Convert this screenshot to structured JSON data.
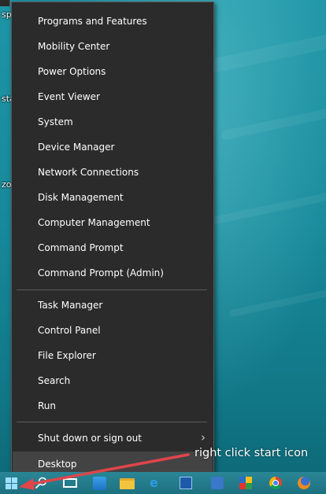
{
  "desktop": {
    "icon_fragments": [
      "sp",
      "sta",
      "zo"
    ]
  },
  "context_menu": {
    "group_1": [
      {
        "label": "Programs and Features"
      },
      {
        "label": "Mobility Center"
      },
      {
        "label": "Power Options"
      },
      {
        "label": "Event Viewer"
      },
      {
        "label": "System"
      },
      {
        "label": "Device Manager"
      },
      {
        "label": "Network Connections"
      },
      {
        "label": "Disk Management"
      },
      {
        "label": "Computer Management"
      },
      {
        "label": "Command Prompt"
      },
      {
        "label": "Command Prompt (Admin)"
      }
    ],
    "group_2": [
      {
        "label": "Task Manager"
      },
      {
        "label": "Control Panel"
      },
      {
        "label": "File Explorer"
      },
      {
        "label": "Search"
      },
      {
        "label": "Run"
      }
    ],
    "group_3": [
      {
        "label": "Shut down or sign out",
        "has_submenu": true,
        "submenu_icon": "chevron-right-icon"
      },
      {
        "label": "Desktop",
        "highlighted": true
      }
    ]
  },
  "annotation": {
    "text": "right click start icon",
    "arrow_color": "#e0454a"
  },
  "taskbar": {
    "icons": [
      "windows-start-icon",
      "search-icon",
      "task-view-icon",
      "store-icon",
      "file-explorer-icon",
      "internet-explorer-icon",
      "app-icon",
      "app-icon",
      "app-icon",
      "chrome-icon",
      "firefox-icon"
    ]
  },
  "colors": {
    "menu_background": "#2b2b2b",
    "menu_highlight": "#434343",
    "menu_text": "#ffffff",
    "wallpaper": "#1a8fa0"
  }
}
